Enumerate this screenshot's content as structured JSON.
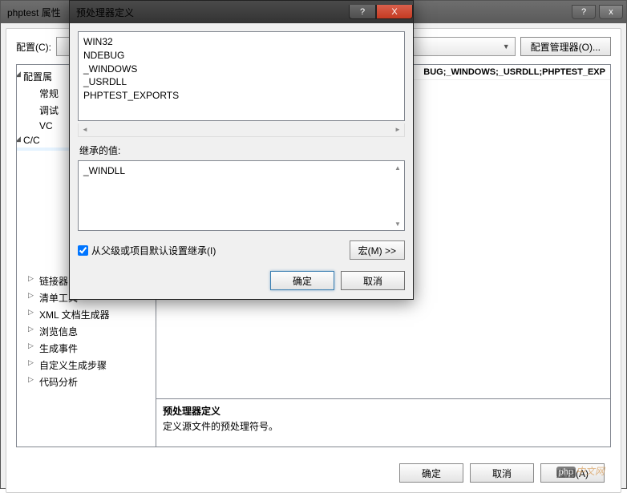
{
  "backWindow": {
    "title": "phptest 属性",
    "help": "?",
    "close": "x",
    "configLabel": "配置(C):",
    "configManager": "配置管理器(O)...",
    "tree": {
      "root": "配置属",
      "items": [
        "常规",
        "调试",
        "VC",
        "C/C",
        "链接器",
        "清单工具",
        "XML 文档生成器",
        "浏览信息",
        "生成事件",
        "自定义生成步骤",
        "代码分析"
      ]
    },
    "gridValue": "BUG;_WINDOWS;_USRDLL;PHPTEST_EXP",
    "desc": {
      "title": "预处理器定义",
      "body": "定义源文件的预处理符号。"
    },
    "buttons": {
      "ok": "确定",
      "cancel": "取消",
      "apply": "应用(A)"
    }
  },
  "frontDialog": {
    "title": "预处理器定义",
    "help": "?",
    "close": "X",
    "definitions": "WIN32\nNDEBUG\n_WINDOWS\n_USRDLL\nPHPTEST_EXPORTS",
    "inheritedLabel": "继承的值:",
    "inheritedValue": "_WINDLL",
    "inheritCheckbox": "从父级或项目默认设置继承(I)",
    "macroButton": "宏(M) >>",
    "ok": "确定",
    "cancel": "取消"
  },
  "watermark": {
    "php": "php",
    "cn": "中文网"
  }
}
